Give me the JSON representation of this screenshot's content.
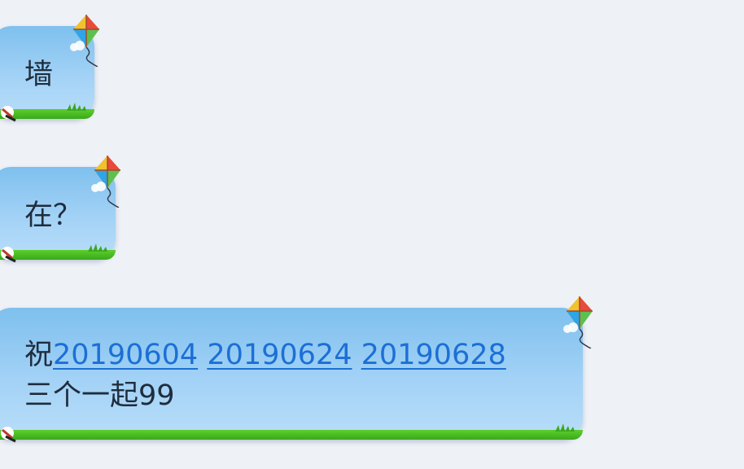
{
  "messages": [
    {
      "text": "墙"
    },
    {
      "text": "在？"
    },
    {
      "prefix": "祝",
      "links": [
        "20190604",
        "20190624",
        "20190628"
      ],
      "second_line": "三个一起99"
    }
  ],
  "colors": {
    "background": "#eef1f6",
    "bubble": "#a3d2f6",
    "grass": "#3aa81c",
    "link": "#1c6fd6",
    "text": "#1f2d3d"
  },
  "icons": [
    "kite-icon",
    "bow-decoration-icon",
    "grass-decoration"
  ]
}
